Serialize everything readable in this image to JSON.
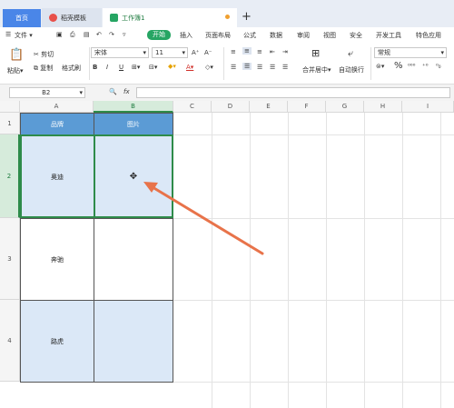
{
  "tabs": {
    "home": "首页",
    "template": "稻壳模板",
    "doc": "工作簿1",
    "add": "+"
  },
  "menu": {
    "file": "文件",
    "start": "开始",
    "items": [
      "插入",
      "页面布局",
      "公式",
      "数据",
      "审阅",
      "视图",
      "安全",
      "开发工具",
      "特色应用"
    ]
  },
  "toolbar": {
    "paste": "粘贴",
    "cut": "剪切",
    "copy": "复制",
    "format_painter": "格式刷",
    "font_name": "宋体",
    "font_size": "11",
    "number_format": "常规",
    "merge": "合并居中",
    "wrap": "自动换行"
  },
  "formula_bar": {
    "name_box": "B2",
    "fx": "fx"
  },
  "columns": [
    "A",
    "B",
    "C",
    "D",
    "E",
    "F",
    "G",
    "H",
    "I"
  ],
  "rows": [
    "1",
    "2",
    "3",
    "4"
  ],
  "table": {
    "header": [
      "品牌",
      "图片"
    ],
    "brands": [
      "奥迪",
      "奔驰",
      "路虎"
    ]
  },
  "colors": {
    "accent": "#26a563",
    "selection": "#2e8b4a",
    "header_fill": "#5b9bd5",
    "band_fill": "#dbe8f7",
    "arrow": "#e8734a"
  }
}
